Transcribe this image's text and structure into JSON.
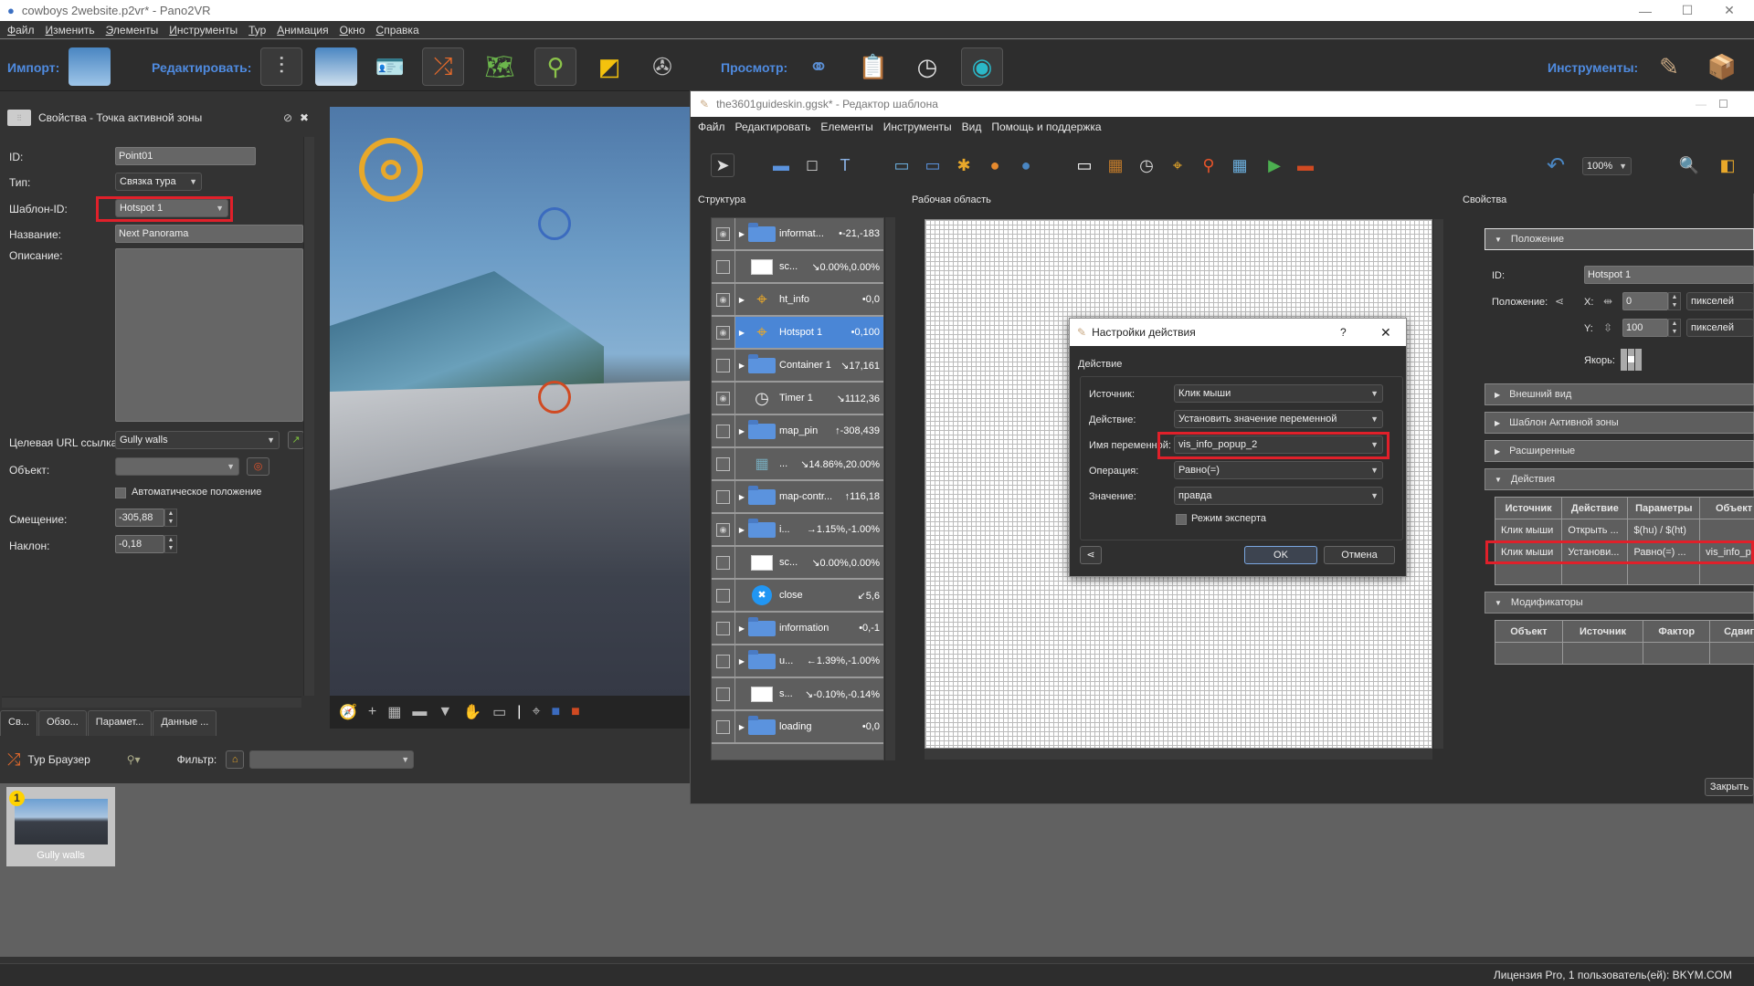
{
  "app": {
    "title": "cowboys 2website.p2vr* - Pano2VR",
    "window_controls": {
      "minimize": "—",
      "maximize": "☐",
      "close": "✕"
    },
    "menu": [
      "Файл",
      "Изменить",
      "Элементы",
      "Инструменты",
      "Тур",
      "Анимация",
      "Окно",
      "Справка"
    ]
  },
  "toolbar": {
    "import_label": "Импорт:",
    "edit_label": "Редактировать:",
    "view_label": "Просмотр:",
    "tools_label": "Инструменты:"
  },
  "properties_panel": {
    "title": "Свойства - Точка активной зоны",
    "fields": {
      "id_label": "ID:",
      "id_value": "Point01",
      "type_label": "Тип:",
      "type_value": "Связка тура",
      "skin_id_label": "Шаблон-ID:",
      "skin_id_value": "Hotspot 1",
      "name_label": "Название:",
      "name_value": "Next Panorama",
      "desc_label": "Описание:",
      "desc_value": "",
      "url_label": "Целевая URL ссылка:",
      "url_value": "Gully walls",
      "object_label": "Объект:",
      "object_value": "",
      "auto_position_label": "Автоматическое положение",
      "auto_position_checked": false,
      "pan_label": "Смещение:",
      "pan_value": "-305,88",
      "tilt_label": "Наклон:",
      "tilt_value": "-0,18"
    },
    "tabs": [
      "Св...",
      "Обзо...",
      "Парамет...",
      "Данные ..."
    ]
  },
  "tour_browser": {
    "label": "Тур Браузер",
    "filter_label": "Фильтр:",
    "filter_value": "",
    "nodes": [
      {
        "index": "1",
        "caption": "Gully walls"
      }
    ]
  },
  "status": {
    "license": "Лицензия Pro, 1 пользователь(ей): BKYM.COM"
  },
  "skin_editor": {
    "title": "the3601guideskin.ggsk* - Редактор шаблона",
    "menu": [
      "Файл",
      "Редактировать",
      "Елементы",
      "Инструменты",
      "Вид",
      "Помощь и поддержка"
    ],
    "zoom": "100%",
    "structure_label": "Структура",
    "workarea_label": "Рабочая область",
    "properties_label": "Свойства",
    "close_button": "Закрыть",
    "tree": [
      {
        "name": "informat...",
        "pos": "•-21,-183",
        "icon": "folder",
        "visible": true,
        "expandable": true
      },
      {
        "name": "sc...",
        "pos": "↘0.00%,0.00%",
        "icon": "rectangle",
        "visible": false,
        "expandable": false
      },
      {
        "name": "ht_info",
        "pos": "•0,0",
        "icon": "hotspot",
        "visible": true,
        "expandable": true
      },
      {
        "name": "Hotspot 1",
        "pos": "•0,100",
        "icon": "hotspot",
        "visible": true,
        "expandable": true,
        "selected": true
      },
      {
        "name": "Container 1",
        "pos": "↘17,161",
        "icon": "folder",
        "visible": false,
        "expandable": true
      },
      {
        "name": "Timer 1",
        "pos": "↘1112,36",
        "icon": "timer",
        "visible": true,
        "expandable": false
      },
      {
        "name": "map_pin",
        "pos": "↑-308,439",
        "icon": "folder",
        "visible": false,
        "expandable": true
      },
      {
        "name": "...",
        "pos": "↘14.86%,20.00%",
        "icon": "map",
        "visible": false,
        "expandable": false
      },
      {
        "name": "map-contr...",
        "pos": "↑116,18",
        "icon": "folder",
        "visible": false,
        "expandable": true
      },
      {
        "name": "i...",
        "pos": "→1.15%,-1.00%",
        "icon": "folder",
        "visible": true,
        "expandable": true
      },
      {
        "name": "sc...",
        "pos": "↘0.00%,0.00%",
        "icon": "rectangle",
        "visible": false,
        "expandable": false
      },
      {
        "name": "close",
        "pos": "↙5,6",
        "icon": "close",
        "visible": false,
        "expandable": false
      },
      {
        "name": "information",
        "pos": "•0,-1",
        "icon": "folder",
        "visible": false,
        "expandable": true
      },
      {
        "name": "u...",
        "pos": "←1.39%,-1.00%",
        "icon": "folder",
        "visible": false,
        "expandable": true
      },
      {
        "name": "s...",
        "pos": "↘-0.10%,-0.14%",
        "icon": "rectangle",
        "visible": false,
        "expandable": false
      },
      {
        "name": "loading",
        "pos": "•0,0",
        "icon": "folder",
        "visible": false,
        "expandable": true
      }
    ],
    "position_section": {
      "header": "Положение",
      "id_label": "ID:",
      "id_value": "Hotspot 1",
      "position_label": "Положение:",
      "x_label": "X:",
      "x_value": "0",
      "x_unit": "пикселей",
      "y_label": "Y:",
      "y_value": "100",
      "y_unit": "пикселей",
      "anchor_label": "Якорь:"
    },
    "sections": [
      "Внешний вид",
      "Шаблон Активной зоны",
      "Расширенные"
    ],
    "actions_section": {
      "header": "Действия",
      "columns": [
        "Источник",
        "Действие",
        "Параметры",
        "Объект"
      ],
      "rows": [
        [
          "Клик мыши",
          "Открыть ...",
          "$(hu) / $(ht)",
          ""
        ],
        [
          "Клик мыши",
          "Установи...",
          "Равно(=) ...",
          "vis_info_p..."
        ]
      ]
    },
    "modifiers_section": {
      "header": "Модификаторы",
      "columns": [
        "Объект",
        "Источник",
        "Фактор",
        "Сдвиг"
      ]
    }
  },
  "action_dialog": {
    "title": "Настройки действия",
    "help": "?",
    "close": "✕",
    "group_label": "Действие",
    "source_label": "Источник:",
    "source_value": "Клик мыши",
    "action_label": "Действие:",
    "action_value": "Установить значение переменной",
    "var_label": "Имя переменной:",
    "var_value": "vis_info_popup_2",
    "op_label": "Операция:",
    "op_value": "Равно(=)",
    "value_label": "Значение:",
    "value_value": "правда",
    "expert_label": "Режим эксперта",
    "expert_checked": false,
    "ok": "OK",
    "cancel": "Отмена"
  },
  "colors": {
    "accent": "#4f8be0",
    "highlight": "#e0202a",
    "selection": "#4a86d6"
  }
}
